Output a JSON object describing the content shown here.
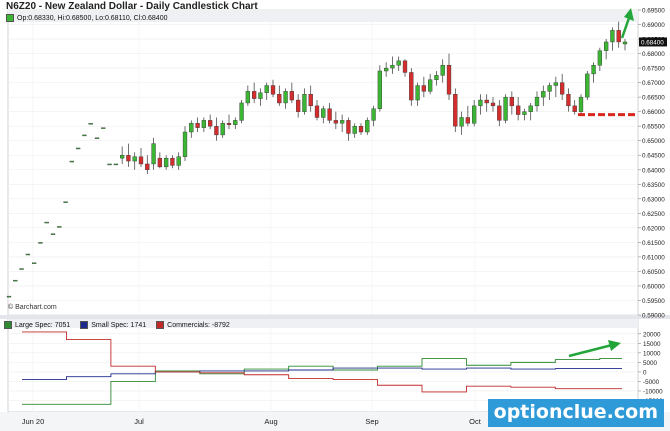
{
  "chart_data": [
    {
      "type": "candlestick",
      "title": "N6Z20 - New Zealand Dollar - Daily Candlestick Chart",
      "ohlc_label": "Op:0.68330, Hi:0.68500, Lo:0.68110, Cl:0.68400",
      "ylim": [
        0.59,
        0.695
      ],
      "y_ticks": [
        "0.69500",
        "0.69000",
        "0.68500",
        "0.68000",
        "0.67500",
        "0.67000",
        "0.66500",
        "0.66000",
        "0.65500",
        "0.65000",
        "0.64500",
        "0.64000",
        "0.63500",
        "0.63000",
        "0.62500",
        "0.62000",
        "0.61500",
        "0.61000",
        "0.60500",
        "0.60000",
        "0.59500",
        "0.59000"
      ],
      "last_price_label": "0.68400",
      "x_labels": [
        "Jun 20",
        "Jul",
        "Aug",
        "Sep",
        "Oct"
      ],
      "candles": [
        {
          "o": 0.5965,
          "h": 0.5965,
          "l": 0.5965,
          "c": 0.5965
        },
        {
          "o": 0.602,
          "h": 0.602,
          "l": 0.602,
          "c": 0.602
        },
        {
          "o": 0.606,
          "h": 0.606,
          "l": 0.606,
          "c": 0.606
        },
        {
          "o": 0.611,
          "h": 0.611,
          "l": 0.611,
          "c": 0.611
        },
        {
          "o": 0.608,
          "h": 0.608,
          "l": 0.608,
          "c": 0.608
        },
        {
          "o": 0.615,
          "h": 0.615,
          "l": 0.615,
          "c": 0.615
        },
        {
          "o": 0.622,
          "h": 0.622,
          "l": 0.622,
          "c": 0.622
        },
        {
          "o": 0.618,
          "h": 0.618,
          "l": 0.618,
          "c": 0.618
        },
        {
          "o": 0.6205,
          "h": 0.6205,
          "l": 0.6205,
          "c": 0.6205
        },
        {
          "o": 0.629,
          "h": 0.629,
          "l": 0.629,
          "c": 0.629
        },
        {
          "o": 0.643,
          "h": 0.643,
          "l": 0.643,
          "c": 0.643
        },
        {
          "o": 0.6475,
          "h": 0.6475,
          "l": 0.6475,
          "c": 0.6475
        },
        {
          "o": 0.652,
          "h": 0.652,
          "l": 0.652,
          "c": 0.652
        },
        {
          "o": 0.656,
          "h": 0.656,
          "l": 0.656,
          "c": 0.656
        },
        {
          "o": 0.651,
          "h": 0.651,
          "l": 0.651,
          "c": 0.651
        },
        {
          "o": 0.6545,
          "h": 0.6545,
          "l": 0.6545,
          "c": 0.6545
        },
        {
          "o": 0.642,
          "h": 0.642,
          "l": 0.642,
          "c": 0.642
        },
        {
          "o": 0.642,
          "h": 0.642,
          "l": 0.642,
          "c": 0.642
        },
        {
          "o": 0.644,
          "h": 0.648,
          "l": 0.642,
          "c": 0.645
        },
        {
          "o": 0.645,
          "h": 0.649,
          "l": 0.641,
          "c": 0.643
        },
        {
          "o": 0.643,
          "h": 0.646,
          "l": 0.64,
          "c": 0.6445
        },
        {
          "o": 0.6445,
          "h": 0.6475,
          "l": 0.641,
          "c": 0.642
        },
        {
          "o": 0.642,
          "h": 0.645,
          "l": 0.6385,
          "c": 0.64
        },
        {
          "o": 0.642,
          "h": 0.651,
          "l": 0.64,
          "c": 0.649
        },
        {
          "o": 0.644,
          "h": 0.646,
          "l": 0.6405,
          "c": 0.641
        },
        {
          "o": 0.641,
          "h": 0.645,
          "l": 0.64,
          "c": 0.644
        },
        {
          "o": 0.644,
          "h": 0.645,
          "l": 0.6405,
          "c": 0.6415
        },
        {
          "o": 0.6415,
          "h": 0.646,
          "l": 0.64,
          "c": 0.6445
        },
        {
          "o": 0.6445,
          "h": 0.655,
          "l": 0.643,
          "c": 0.653
        },
        {
          "o": 0.653,
          "h": 0.657,
          "l": 0.651,
          "c": 0.656
        },
        {
          "o": 0.656,
          "h": 0.658,
          "l": 0.653,
          "c": 0.6545
        },
        {
          "o": 0.6545,
          "h": 0.658,
          "l": 0.653,
          "c": 0.657
        },
        {
          "o": 0.657,
          "h": 0.659,
          "l": 0.654,
          "c": 0.655
        },
        {
          "o": 0.655,
          "h": 0.658,
          "l": 0.65,
          "c": 0.652
        },
        {
          "o": 0.652,
          "h": 0.657,
          "l": 0.651,
          "c": 0.656
        },
        {
          "o": 0.656,
          "h": 0.659,
          "l": 0.654,
          "c": 0.6555
        },
        {
          "o": 0.6555,
          "h": 0.658,
          "l": 0.654,
          "c": 0.657
        },
        {
          "o": 0.657,
          "h": 0.664,
          "l": 0.656,
          "c": 0.663
        },
        {
          "o": 0.663,
          "h": 0.669,
          "l": 0.662,
          "c": 0.667
        },
        {
          "o": 0.667,
          "h": 0.67,
          "l": 0.663,
          "c": 0.6645
        },
        {
          "o": 0.6645,
          "h": 0.668,
          "l": 0.662,
          "c": 0.6665
        },
        {
          "o": 0.6665,
          "h": 0.67,
          "l": 0.664,
          "c": 0.669
        },
        {
          "o": 0.669,
          "h": 0.671,
          "l": 0.665,
          "c": 0.666
        },
        {
          "o": 0.666,
          "h": 0.669,
          "l": 0.662,
          "c": 0.663
        },
        {
          "o": 0.663,
          "h": 0.668,
          "l": 0.661,
          "c": 0.667
        },
        {
          "o": 0.667,
          "h": 0.67,
          "l": 0.663,
          "c": 0.664
        },
        {
          "o": 0.664,
          "h": 0.666,
          "l": 0.658,
          "c": 0.66
        },
        {
          "o": 0.66,
          "h": 0.668,
          "l": 0.659,
          "c": 0.666
        },
        {
          "o": 0.666,
          "h": 0.669,
          "l": 0.66,
          "c": 0.662
        },
        {
          "o": 0.662,
          "h": 0.664,
          "l": 0.657,
          "c": 0.658
        },
        {
          "o": 0.658,
          "h": 0.662,
          "l": 0.656,
          "c": 0.661
        },
        {
          "o": 0.661,
          "h": 0.663,
          "l": 0.656,
          "c": 0.657
        },
        {
          "o": 0.657,
          "h": 0.66,
          "l": 0.654,
          "c": 0.656
        },
        {
          "o": 0.656,
          "h": 0.659,
          "l": 0.653,
          "c": 0.657
        },
        {
          "o": 0.657,
          "h": 0.658,
          "l": 0.65,
          "c": 0.6525
        },
        {
          "o": 0.6525,
          "h": 0.656,
          "l": 0.651,
          "c": 0.655
        },
        {
          "o": 0.655,
          "h": 0.656,
          "l": 0.652,
          "c": 0.653
        },
        {
          "o": 0.653,
          "h": 0.658,
          "l": 0.652,
          "c": 0.657
        },
        {
          "o": 0.657,
          "h": 0.662,
          "l": 0.655,
          "c": 0.661
        },
        {
          "o": 0.661,
          "h": 0.676,
          "l": 0.66,
          "c": 0.674
        },
        {
          "o": 0.674,
          "h": 0.677,
          "l": 0.672,
          "c": 0.675
        },
        {
          "o": 0.675,
          "h": 0.679,
          "l": 0.673,
          "c": 0.676
        },
        {
          "o": 0.676,
          "h": 0.679,
          "l": 0.674,
          "c": 0.6775
        },
        {
          "o": 0.6775,
          "h": 0.678,
          "l": 0.672,
          "c": 0.6735
        },
        {
          "o": 0.6735,
          "h": 0.675,
          "l": 0.662,
          "c": 0.664
        },
        {
          "o": 0.664,
          "h": 0.67,
          "l": 0.662,
          "c": 0.669
        },
        {
          "o": 0.669,
          "h": 0.672,
          "l": 0.665,
          "c": 0.667
        },
        {
          "o": 0.667,
          "h": 0.673,
          "l": 0.666,
          "c": 0.671
        },
        {
          "o": 0.671,
          "h": 0.674,
          "l": 0.669,
          "c": 0.6725
        },
        {
          "o": 0.6725,
          "h": 0.678,
          "l": 0.67,
          "c": 0.676
        },
        {
          "o": 0.676,
          "h": 0.68,
          "l": 0.664,
          "c": 0.666
        },
        {
          "o": 0.666,
          "h": 0.668,
          "l": 0.653,
          "c": 0.655
        },
        {
          "o": 0.655,
          "h": 0.66,
          "l": 0.652,
          "c": 0.658
        },
        {
          "o": 0.658,
          "h": 0.662,
          "l": 0.655,
          "c": 0.656
        },
        {
          "o": 0.656,
          "h": 0.664,
          "l": 0.655,
          "c": 0.662
        },
        {
          "o": 0.662,
          "h": 0.666,
          "l": 0.659,
          "c": 0.664
        },
        {
          "o": 0.664,
          "h": 0.666,
          "l": 0.66,
          "c": 0.663
        },
        {
          "o": 0.663,
          "h": 0.665,
          "l": 0.66,
          "c": 0.662
        },
        {
          "o": 0.662,
          "h": 0.664,
          "l": 0.655,
          "c": 0.657
        },
        {
          "o": 0.657,
          "h": 0.666,
          "l": 0.656,
          "c": 0.665
        },
        {
          "o": 0.665,
          "h": 0.667,
          "l": 0.659,
          "c": 0.662
        },
        {
          "o": 0.662,
          "h": 0.665,
          "l": 0.657,
          "c": 0.659
        },
        {
          "o": 0.659,
          "h": 0.661,
          "l": 0.657,
          "c": 0.66
        },
        {
          "o": 0.66,
          "h": 0.663,
          "l": 0.657,
          "c": 0.662
        },
        {
          "o": 0.662,
          "h": 0.667,
          "l": 0.66,
          "c": 0.665
        },
        {
          "o": 0.665,
          "h": 0.669,
          "l": 0.662,
          "c": 0.667
        },
        {
          "o": 0.667,
          "h": 0.67,
          "l": 0.664,
          "c": 0.669
        },
        {
          "o": 0.669,
          "h": 0.672,
          "l": 0.665,
          "c": 0.67
        },
        {
          "o": 0.67,
          "h": 0.673,
          "l": 0.664,
          "c": 0.666
        },
        {
          "o": 0.666,
          "h": 0.668,
          "l": 0.66,
          "c": 0.662
        },
        {
          "o": 0.662,
          "h": 0.664,
          "l": 0.659,
          "c": 0.66
        },
        {
          "o": 0.66,
          "h": 0.666,
          "l": 0.659,
          "c": 0.665
        },
        {
          "o": 0.665,
          "h": 0.674,
          "l": 0.664,
          "c": 0.673
        },
        {
          "o": 0.673,
          "h": 0.677,
          "l": 0.67,
          "c": 0.676
        },
        {
          "o": 0.676,
          "h": 0.682,
          "l": 0.674,
          "c": 0.681
        },
        {
          "o": 0.681,
          "h": 0.685,
          "l": 0.678,
          "c": 0.684
        },
        {
          "o": 0.684,
          "h": 0.689,
          "l": 0.681,
          "c": 0.688
        },
        {
          "o": 0.688,
          "h": 0.691,
          "l": 0.682,
          "c": 0.684
        },
        {
          "o": 0.6833,
          "h": 0.685,
          "l": 0.6811,
          "c": 0.684
        }
      ],
      "annotations": [
        {
          "type": "arrow",
          "direction": "up",
          "color": "#22a63a"
        },
        {
          "type": "dashed-line",
          "level": 0.659,
          "color": "#d8281c"
        }
      ],
      "colors": {
        "up": "#3cb534",
        "down": "#d32d2d"
      }
    },
    {
      "type": "step-line",
      "source": "Barchart.com",
      "ylim": [
        -20000,
        22000
      ],
      "y_ticks": [
        "20000",
        "15000",
        "10000",
        "5000",
        "0",
        "-5000",
        "-10000",
        "-15000"
      ],
      "series": [
        {
          "name": "Large Spec",
          "legend": "Large Spec: 7051",
          "color": "#2f8a33",
          "values": [
            -17000,
            -17000,
            -17000,
            -17000,
            -5000,
            -5000,
            500,
            500,
            -1000,
            -1000,
            1500,
            1500,
            3000,
            3000,
            1000,
            1000,
            3000,
            3000,
            7000,
            7000,
            3500,
            3500,
            5000,
            5000,
            6500,
            6500,
            7051,
            7051
          ]
        },
        {
          "name": "Small Spec",
          "legend": "Small Spec: 1741",
          "color": "#1e2a8c",
          "values": [
            -4000,
            -4000,
            -2500,
            -2500,
            -1000,
            -1000,
            0,
            0,
            500,
            500,
            500,
            500,
            1000,
            1000,
            2000,
            2000,
            2000,
            2000,
            1500,
            1500,
            2000,
            2000,
            1500,
            1500,
            1741,
            1741,
            1741,
            1741
          ]
        },
        {
          "name": "Commercials",
          "legend": "Commercials: -8792",
          "color": "#c22a2a",
          "values": [
            21000,
            21000,
            17000,
            17000,
            3000,
            3000,
            0,
            0,
            -500,
            -500,
            -1500,
            -1500,
            -3500,
            -3500,
            -4000,
            -4000,
            -7000,
            -7000,
            -10500,
            -10500,
            -7500,
            -7500,
            -8000,
            -8000,
            -8792,
            -8792,
            -8792,
            -8792
          ]
        }
      ],
      "annotations": [
        {
          "type": "arrow",
          "direction": "up-right",
          "color": "#22a63a"
        }
      ]
    }
  ],
  "watermark": "optionclue.com"
}
